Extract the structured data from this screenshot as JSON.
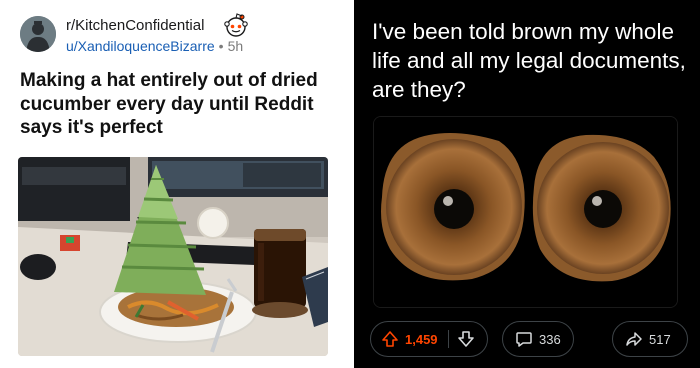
{
  "left_post": {
    "subreddit": "r/KitchenConfidential",
    "username": "u/XandiloquenceBizarre",
    "separator": "•",
    "age": "5h",
    "title": "Making a hat entirely out of dried cucumber every day until Reddit says it's perfect",
    "avatar_icon": "user-avatar",
    "badge_icon": "reddit-snoo-icon",
    "photo": "cucumber-hat-plate-photo"
  },
  "right_post": {
    "title": "I've been told brown my whole life and all my legal documents, are they?",
    "image": "two-brown-eyes-image",
    "upvotes": "1,459",
    "comments": "336",
    "shares": "517",
    "accent_color": "#ff4500"
  }
}
